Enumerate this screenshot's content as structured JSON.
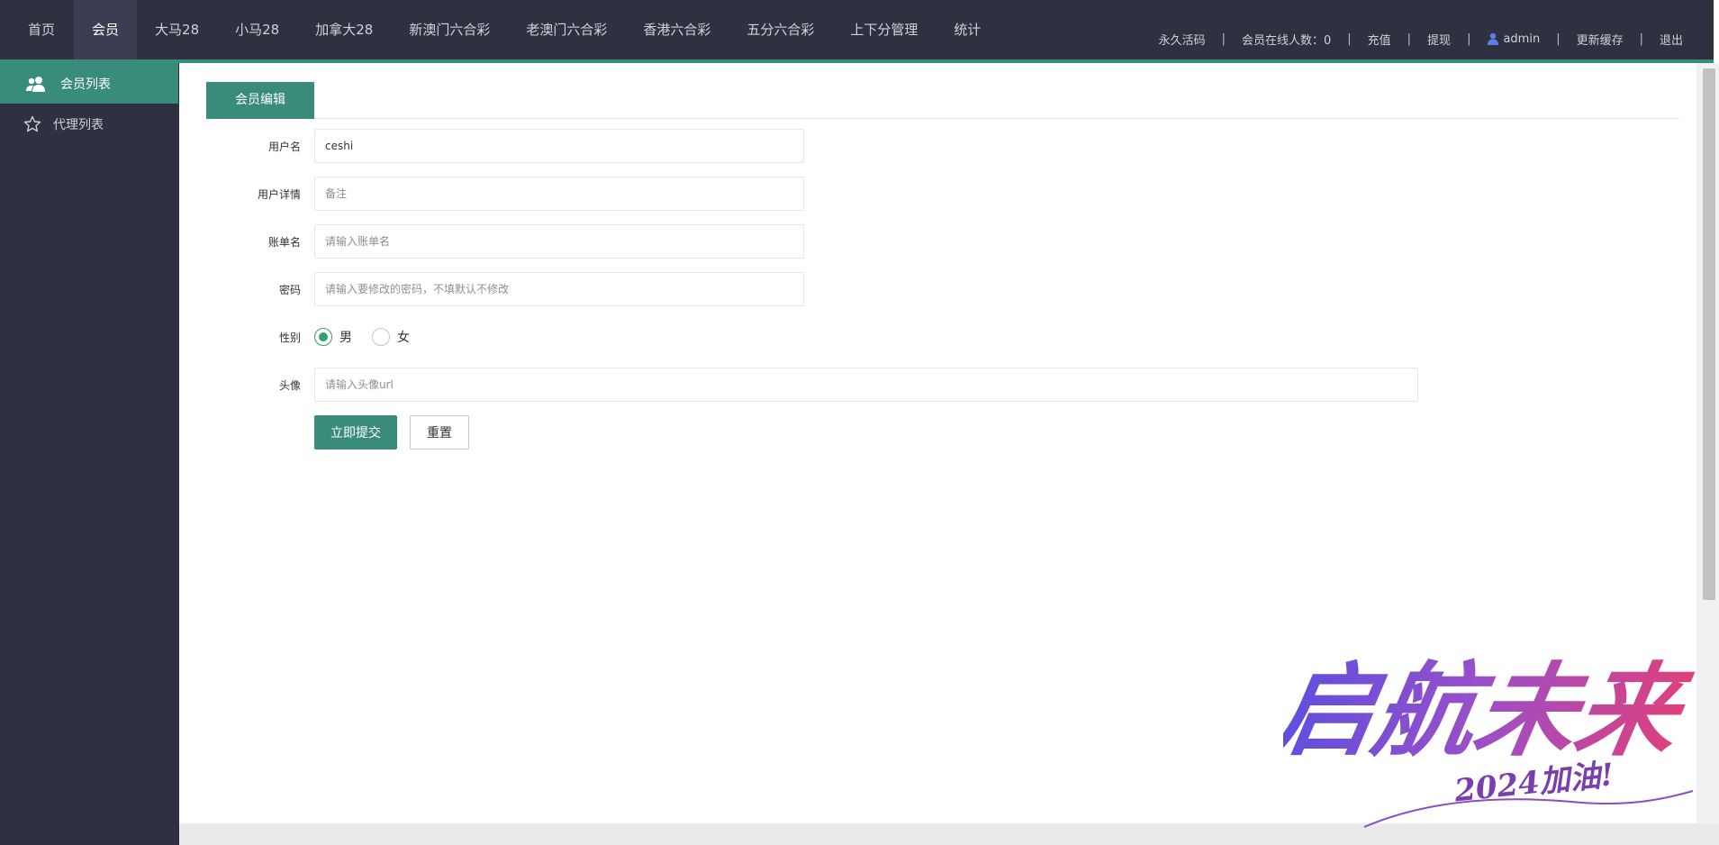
{
  "header": {
    "nav": [
      {
        "label": "首页",
        "active": false
      },
      {
        "label": "会员",
        "active": true
      },
      {
        "label": "大马28",
        "active": false
      },
      {
        "label": "小马28",
        "active": false
      },
      {
        "label": "加拿大28",
        "active": false
      },
      {
        "label": "新澳门六合彩",
        "active": false
      },
      {
        "label": "老澳门六合彩",
        "active": false
      },
      {
        "label": "香港六合彩",
        "active": false
      },
      {
        "label": "五分六合彩",
        "active": false
      },
      {
        "label": "上下分管理",
        "active": false
      },
      {
        "label": "统计",
        "active": false
      }
    ],
    "right": {
      "activation_code": "永久活码",
      "online_members": "会员在线人数：0",
      "recharge": "充值",
      "withdraw": "提现",
      "user": "admin",
      "refresh_cache": "更新缓存",
      "logout": "退出",
      "separator": "|"
    }
  },
  "sidebar": {
    "items": [
      {
        "label": "会员列表",
        "icon": "users-icon",
        "active": true
      },
      {
        "label": "代理列表",
        "icon": "star-icon",
        "active": false
      }
    ]
  },
  "main": {
    "tab": "会员编辑",
    "form": {
      "username": {
        "label": "用户名",
        "value": "ceshi",
        "placeholder": ""
      },
      "user_detail": {
        "label": "用户详情",
        "value": "",
        "placeholder": "备注"
      },
      "bill_name": {
        "label": "账单名",
        "value": "",
        "placeholder": "请输入账单名"
      },
      "password": {
        "label": "密码",
        "value": "",
        "placeholder": "请输入要修改的密码，不填默认不修改"
      },
      "gender": {
        "label": "性别",
        "options": [
          "男",
          "女"
        ],
        "selected": "男"
      },
      "avatar": {
        "label": "头像",
        "value": "",
        "placeholder": "请输入头像url"
      }
    },
    "buttons": {
      "submit": "立即提交",
      "reset": "重置"
    }
  },
  "watermark": {
    "main_text": "启航未来",
    "sub_text": "2024加油!"
  },
  "colors": {
    "header_bg": "#2f3140",
    "accent": "#3a8c7a",
    "radio_checked": "#3a9e6a",
    "watermark_gradient": [
      "#5b4fe0",
      "#9b4fc8",
      "#e0407a"
    ]
  }
}
